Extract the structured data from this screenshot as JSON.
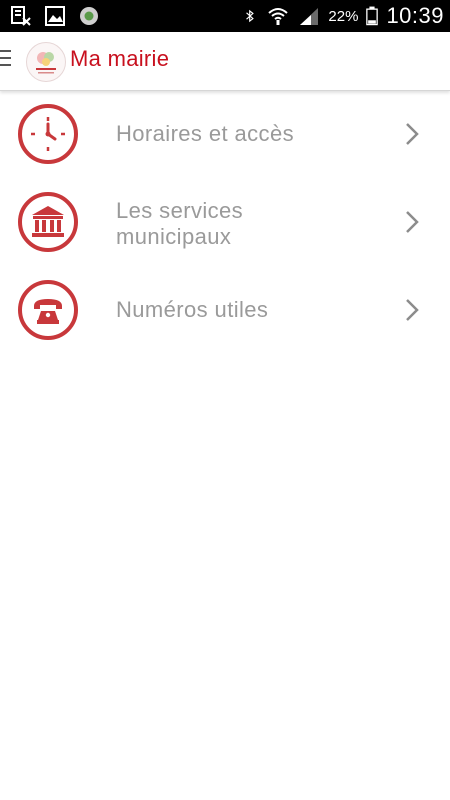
{
  "status_bar": {
    "battery_percent": "22%",
    "time": "10:39",
    "left_icons": [
      "storage-icon",
      "image-icon",
      "app-notification-icon"
    ],
    "right_icons": [
      "bluetooth-icon",
      "wifi-icon",
      "signal-icon",
      "battery-icon"
    ]
  },
  "app_bar": {
    "title": "Ma mairie",
    "menu_icon": "hamburger-menu-icon",
    "logo": "mairie-logo"
  },
  "menu": {
    "items": [
      {
        "label": "Horaires et accès",
        "icon": "clock-icon"
      },
      {
        "label_line1": "Les services",
        "label_line2": "municipaux",
        "icon": "town-hall-icon"
      },
      {
        "label": "Numéros utiles",
        "icon": "telephone-icon"
      }
    ]
  },
  "colors": {
    "accent_red": "#c8101e",
    "icon_red": "#c8383b",
    "label_gray": "#9a9a9a",
    "chevron_gray": "#8c8c8c"
  }
}
